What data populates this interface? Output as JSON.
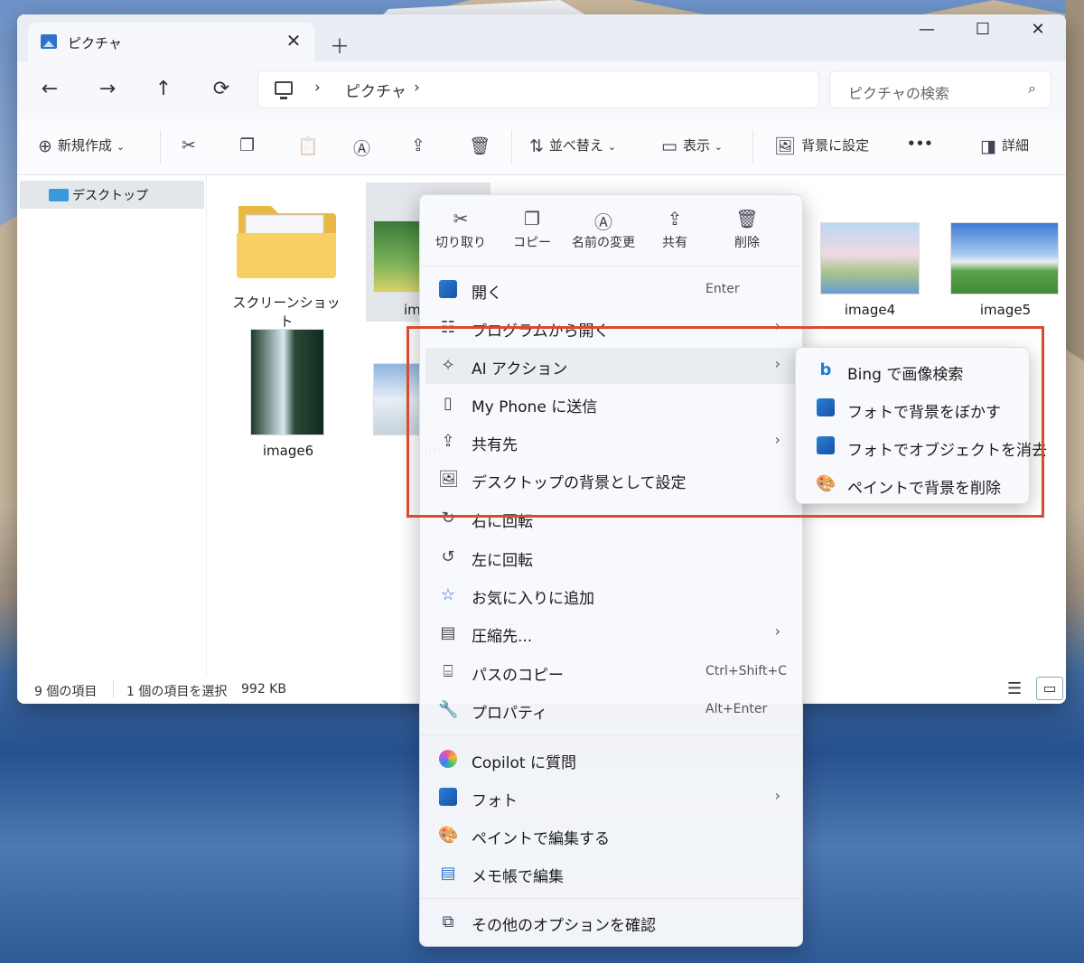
{
  "window": {
    "tab_title": "ピクチャ",
    "close_tab": "✕",
    "new_tab": "＋",
    "minimize": "—",
    "maximize": "☐",
    "close": "✕"
  },
  "nav": {
    "back": "←",
    "forward": "→",
    "up": "↑",
    "refresh": "⟳",
    "breadcrumb_sep1": "›",
    "location": "ピクチャ",
    "breadcrumb_sep2": "›",
    "search_placeholder": "ピクチャの検索"
  },
  "toolbar": {
    "new_label": "新規作成",
    "new_caret": "⌄",
    "sort_label": "並べ替え",
    "sort_caret": "⌄",
    "view_label": "表示",
    "view_caret": "⌄",
    "set_bg_label": "背景に設定",
    "more": "•••",
    "details_label": "詳細"
  },
  "sidebar": {
    "items": [
      {
        "label": "デスクトップ"
      }
    ]
  },
  "files": [
    {
      "name": "スクリーンショット"
    },
    {
      "name": "image4"
    },
    {
      "name": "image5"
    },
    {
      "name": "image6"
    },
    {
      "name": "im"
    },
    {
      "name": "im"
    }
  ],
  "status": {
    "count": "9 個の項目",
    "selected": "1 個の項目を選択",
    "size": "992 KB"
  },
  "context_menu": {
    "quick_actions": [
      {
        "label": "切り取り",
        "icon": "✂"
      },
      {
        "label": "コピー",
        "icon": "❐"
      },
      {
        "label": "名前の変更",
        "icon": "Ⓐ"
      },
      {
        "label": "共有",
        "icon": "⇪"
      },
      {
        "label": "削除",
        "icon": "🗑"
      }
    ],
    "items": [
      {
        "label": "開く",
        "shortcut": "Enter"
      },
      {
        "label": "プログラムから開く",
        "arrow": "›"
      },
      {
        "label": "AI アクション",
        "arrow": "›"
      },
      {
        "label": "My Phone に送信"
      },
      {
        "label": "共有先",
        "arrow": "›"
      },
      {
        "label": "デスクトップの背景として設定"
      },
      {
        "label": "右に回転"
      },
      {
        "label": "左に回転"
      },
      {
        "label": "お気に入りに追加"
      },
      {
        "label": "圧縮先...",
        "arrow": "›"
      },
      {
        "label": "パスのコピー",
        "shortcut": "Ctrl+Shift+C"
      },
      {
        "label": "プロパティ",
        "shortcut": "Alt+Enter"
      },
      {
        "label": "Copilot に質問"
      },
      {
        "label": "フォト",
        "arrow": "›"
      },
      {
        "label": "ペイントで編集する"
      },
      {
        "label": "メモ帳で編集"
      },
      {
        "label": "その他のオプションを確認"
      }
    ]
  },
  "submenu": {
    "items": [
      {
        "label": "Bing で画像検索",
        "icon": "b"
      },
      {
        "label": "フォトで背景をぼかす"
      },
      {
        "label": "フォトでオブジェクトを消去"
      },
      {
        "label": "ペイントで背景を削除",
        "icon": "🎨"
      }
    ]
  },
  "colors": {
    "accent": "#2f72c9",
    "highlight_box": "#d94b30"
  }
}
